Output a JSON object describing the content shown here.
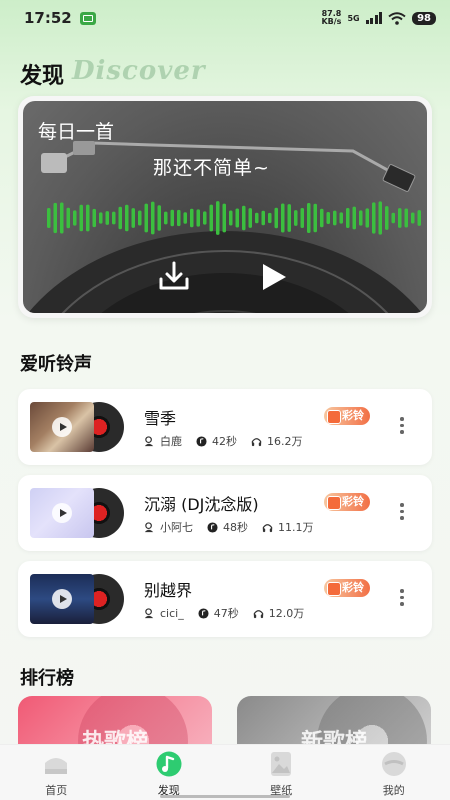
{
  "status_bar": {
    "time": "17:52",
    "net_speed_value": "87.8",
    "net_speed_unit": "KB/s",
    "network": "5G",
    "battery": "98"
  },
  "header": {
    "title": "发现",
    "title_en": "Discover"
  },
  "daily": {
    "label": "每日一首",
    "song": "那还不简单~",
    "icons": [
      "download-icon",
      "play-icon"
    ],
    "accent_color": "#3bbf3f"
  },
  "ringtones": {
    "section_title": "爱听铃声",
    "tag_label": "彩铃",
    "items": [
      {
        "name": "雪季",
        "artist": "白鹿",
        "duration": "42秒",
        "plays": "16.2万"
      },
      {
        "name": "沉溺 (DJ沈念版)",
        "artist": "小阿七",
        "duration": "48秒",
        "plays": "11.1万"
      },
      {
        "name": "别越界",
        "artist": "cici_",
        "duration": "47秒",
        "plays": "12.0万"
      }
    ]
  },
  "charts": {
    "section_title": "排行榜",
    "items": [
      {
        "label": "热歌榜",
        "color": "#f05a75"
      },
      {
        "label": "新歌榜",
        "color": "#8a8a8a"
      }
    ]
  },
  "tabs": [
    {
      "label": "首页",
      "icon": "home-icon"
    },
    {
      "label": "发现",
      "icon": "discover-icon",
      "active": true
    },
    {
      "label": "壁纸",
      "icon": "wallpaper-icon"
    },
    {
      "label": "我的",
      "icon": "profile-icon"
    }
  ]
}
